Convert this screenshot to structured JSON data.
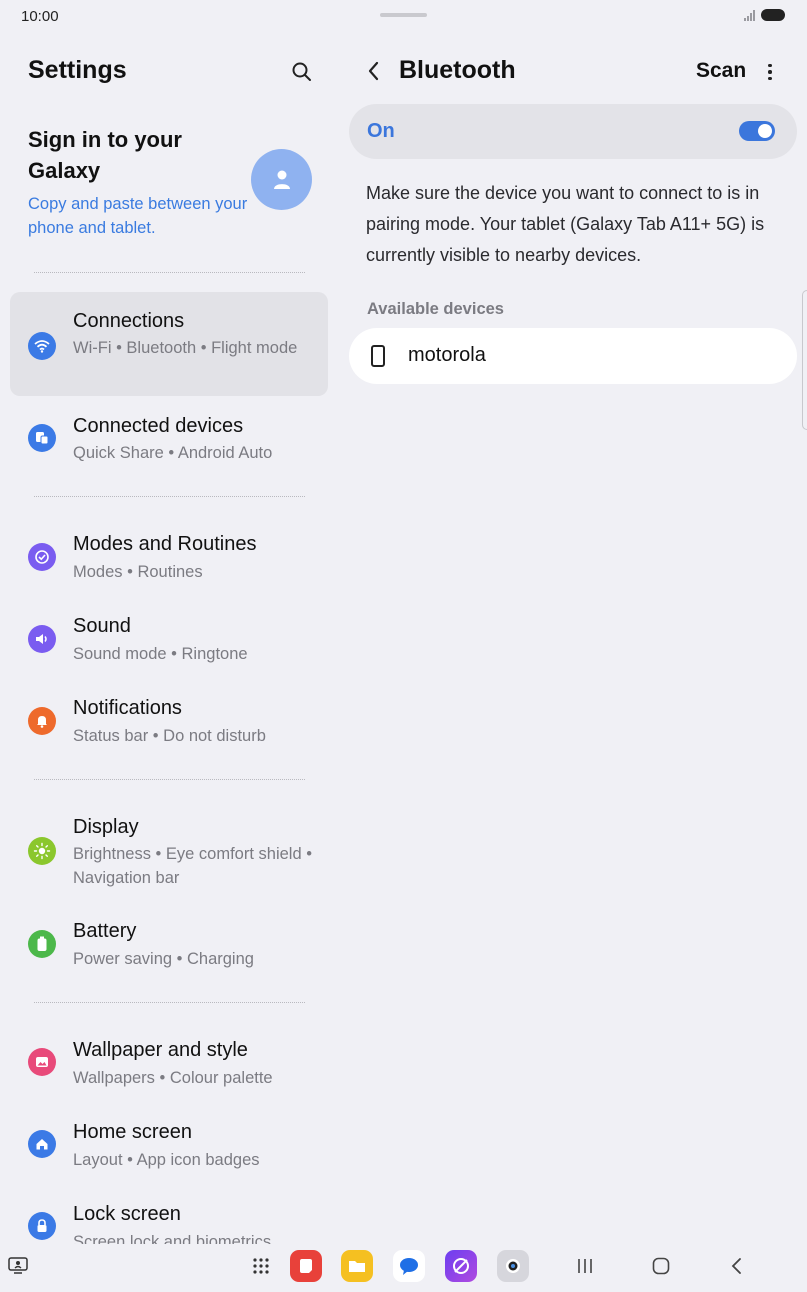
{
  "status_bar": {
    "time": "10:00"
  },
  "left_pane": {
    "title": "Settings",
    "account": {
      "title": "Sign in to your Galaxy",
      "subtitle": "Copy and paste between your phone and tablet."
    },
    "items": [
      {
        "label": "Connections",
        "sub": "Wi-Fi • Bluetooth • Flight mode",
        "icon": "wifi-icon",
        "color": "#3b7ae6",
        "selected": true
      },
      {
        "label": "Connected devices",
        "sub": "Quick Share • Android Auto",
        "icon": "connected-devices-icon",
        "color": "#3b7ae6"
      },
      {
        "label": "Modes and Routines",
        "sub": "Modes • Routines",
        "icon": "modes-icon",
        "color": "#7a5cf0"
      },
      {
        "label": "Sound",
        "sub": "Sound mode • Ringtone",
        "icon": "speaker-icon",
        "color": "#7a5cf0"
      },
      {
        "label": "Notifications",
        "sub": "Status bar • Do not disturb",
        "icon": "bell-icon",
        "color": "#ee6a2c"
      },
      {
        "label": "Display",
        "sub": "Brightness • Eye comfort shield • Navigation bar",
        "icon": "sun-icon",
        "color": "#8bc72d"
      },
      {
        "label": "Battery",
        "sub": "Power saving • Charging",
        "icon": "battery-icon",
        "color": "#4cb84a"
      },
      {
        "label": "Wallpaper and style",
        "sub": "Wallpapers • Colour palette",
        "icon": "wallpaper-icon",
        "color": "#e84a7a"
      },
      {
        "label": "Home screen",
        "sub": "Layout • App icon badges",
        "icon": "home-icon",
        "color": "#3b7ae6"
      },
      {
        "label": "Lock screen",
        "sub": "Screen lock and biometrics",
        "icon": "lock-icon",
        "color": "#3b7ae6"
      }
    ]
  },
  "right_pane": {
    "title": "Bluetooth",
    "scan_label": "Scan",
    "toggle": {
      "label": "On",
      "state": true,
      "color": "#3b76dc"
    },
    "info": "Make sure the device you want to connect to is in pairing mode. Your tablet (Galaxy Tab A11+ 5G) is currently visible to nearby devices.",
    "available_label": "Available devices",
    "devices": [
      {
        "name": "motorola",
        "icon": "phone-icon"
      }
    ]
  },
  "taskbar": {
    "apps": [
      "apps-grid-icon",
      "notes-app-icon",
      "my-files-app-icon",
      "messages-app-icon",
      "internet-app-icon",
      "camera-app-icon"
    ],
    "nav": [
      "recents-nav",
      "home-nav",
      "back-nav"
    ]
  }
}
